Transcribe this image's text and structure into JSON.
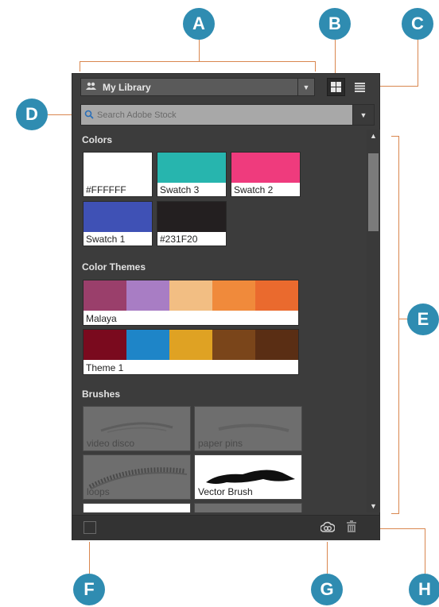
{
  "callouts": {
    "a": "A",
    "b": "B",
    "c": "C",
    "d": "D",
    "e": "E",
    "f": "F",
    "g": "G",
    "h": "H"
  },
  "header": {
    "library_label": "My Library",
    "library_icon": "people-icon",
    "grid_view_icon": "grid-view-icon",
    "list_view_icon": "list-view-icon"
  },
  "search": {
    "placeholder": "Search Adobe Stock",
    "value": ""
  },
  "sections": {
    "colors": {
      "title": "Colors",
      "items": [
        {
          "label": "#FFFFFF",
          "color": "#FFFFFF"
        },
        {
          "label": "Swatch 3",
          "color": "#27B5AE"
        },
        {
          "label": "Swatch 2",
          "color": "#EF3B7D"
        },
        {
          "label": "Swatch 1",
          "color": "#3F51B5"
        },
        {
          "label": "#231F20",
          "color": "#231F20"
        }
      ]
    },
    "color_themes": {
      "title": "Color Themes",
      "items": [
        {
          "label": "Malaya",
          "colors": [
            "#9A3F6B",
            "#A87DC4",
            "#F2BE83",
            "#F08A3B",
            "#EA6A2E"
          ]
        },
        {
          "label": "Theme 1",
          "colors": [
            "#7A0A1E",
            "#1E85C8",
            "#DFA223",
            "#7A451A",
            "#5A2E14"
          ]
        }
      ]
    },
    "brushes": {
      "title": "Brushes",
      "items": [
        {
          "label": "video disco"
        },
        {
          "label": "paper pins"
        },
        {
          "label": "loops"
        },
        {
          "label": "Vector Brush"
        }
      ]
    }
  },
  "colors": {
    "callout": "#2F8CB1",
    "callout_line": "#D9874F",
    "panel_bg": "#3C3C3C"
  },
  "icons": {
    "search": "search-icon",
    "dropdown": "chevron-down-icon",
    "scroll_up": "triangle-up-icon",
    "scroll_down": "triangle-down-icon",
    "creative_cloud": "creative-cloud-icon",
    "trash": "trash-icon"
  }
}
